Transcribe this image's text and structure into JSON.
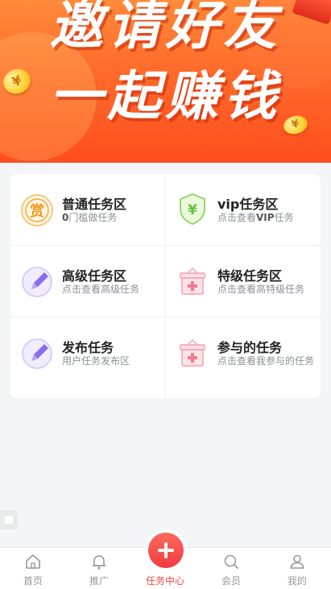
{
  "banner": {
    "line1": "邀请好友",
    "line2": "一起赚钱",
    "coin_symbol": "¥"
  },
  "tasks": {
    "items": [
      {
        "title": "普通任务区",
        "sub_count": "0",
        "sub_text": "门槛做任务",
        "icon": "reward-badge-icon"
      },
      {
        "title": "vip任务区",
        "sub_prefix": "点击查看",
        "sub_bold": "VIP",
        "sub_suffix": "任务",
        "icon": "yuan-shield-icon"
      },
      {
        "title": "高级任务区",
        "sub": "点击查看高级任务",
        "icon": "pen-icon"
      },
      {
        "title": "特级任务区",
        "sub": "点击查看高特级任务",
        "icon": "medical-box-icon"
      },
      {
        "title": "发布任务",
        "sub": "用户任务发布区",
        "icon": "pen-icon"
      },
      {
        "title": "参与的任务",
        "sub": "点击查看我参与的任务",
        "icon": "medical-box-icon"
      }
    ],
    "reward_glyph": "赏"
  },
  "tabbar": {
    "items": [
      {
        "label": "首页",
        "icon": "home-icon"
      },
      {
        "label": "推广",
        "icon": "bell-icon"
      },
      {
        "label": "任务中心",
        "icon": "plus-icon",
        "active": true
      },
      {
        "label": "会员",
        "icon": "search-icon"
      },
      {
        "label": "我的",
        "icon": "user-icon"
      }
    ]
  },
  "colors": {
    "accent": "#f0484a",
    "banner_top": "#ff8a3a",
    "banner_bottom": "#ff4e1f",
    "reward_orange": "#f7a535",
    "shield_green": "#8fd15a",
    "pen_purple": "#8a6cf0",
    "box_pink": "#f07a8e"
  }
}
